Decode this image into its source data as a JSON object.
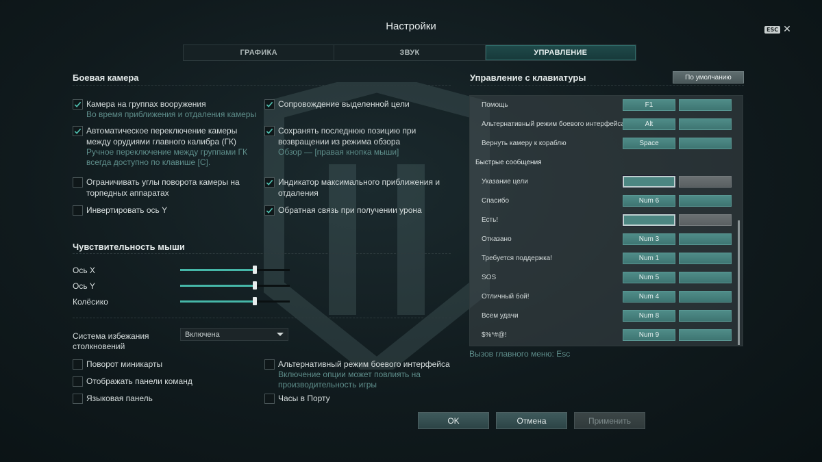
{
  "window": {
    "title": "Настройки",
    "esc_label": "ESC",
    "close_glyph": "✕"
  },
  "tabs": [
    {
      "label": "ГРАФИКА",
      "active": false
    },
    {
      "label": "ЗВУК",
      "active": false
    },
    {
      "label": "УПРАВЛЕНИЕ",
      "active": true
    }
  ],
  "camera": {
    "title": "Боевая камера",
    "left": [
      {
        "label": "Камера на группах вооружения",
        "sub": "Во время приближения и отдаления камеры",
        "checked": true
      },
      {
        "label": "Автоматическое переключение камеры между орудиями главного калибра (ГК)",
        "sub": "Ручное переключение между группами ГК всегда доступно по клавише [C].",
        "checked": true
      },
      {
        "label": "Ограничивать углы поворота камеры на торпедных аппаратах",
        "sub": "",
        "checked": false
      },
      {
        "label": "Инвертировать ось Y",
        "sub": "",
        "checked": false
      }
    ],
    "right": [
      {
        "label": "Сопровождение выделенной цели",
        "sub": "",
        "checked": true
      },
      {
        "label": "Сохранять последнюю позицию при возвращении из режима обзора",
        "sub": "Обзор — [правая кнопка мыши]",
        "checked": true
      },
      {
        "label": "Индикатор максимального приближения и отдаления",
        "sub": "",
        "checked": true
      },
      {
        "label": "Обратная связь при получении урона",
        "sub": "",
        "checked": true
      }
    ]
  },
  "mouse": {
    "title": "Чувствительность мыши",
    "sliders": [
      {
        "label": "Ось X",
        "value": 0.68
      },
      {
        "label": "Ось Y",
        "value": 0.68
      },
      {
        "label": "Колёсико",
        "value": 0.68
      }
    ]
  },
  "collision": {
    "label": "Система избежания столкновений",
    "selected": "Включена"
  },
  "misc": {
    "left": [
      {
        "label": "Поворот миникарты",
        "checked": false
      },
      {
        "label": "Отображать панели команд",
        "checked": false
      },
      {
        "label": "Языковая панель",
        "checked": false
      }
    ],
    "right": [
      {
        "label": "Альтернативный режим боевого интерфейса",
        "sub": "Включение опции может повлиять на производительность игры",
        "checked": false
      },
      {
        "label": "Часы в Порту",
        "sub": "",
        "checked": false
      }
    ]
  },
  "keyboard": {
    "title": "Управление с клавиатуры",
    "default_label": "По умолчанию",
    "group_label": "Быстрые сообщения",
    "rows_top": [
      {
        "name": "Помощь",
        "k1": "F1",
        "k2": ""
      },
      {
        "name": "Альтернативный режим боевого интерфейса",
        "k1": "Alt",
        "k2": ""
      },
      {
        "name": "Вернуть камеру к кораблю",
        "k1": "Space",
        "k2": ""
      }
    ],
    "rows_messages": [
      {
        "name": "Указание цели",
        "k1": "",
        "k2": "",
        "state": "selected"
      },
      {
        "name": "Спасибо",
        "k1": "Num 6",
        "k2": ""
      },
      {
        "name": "Есть!",
        "k1": "",
        "k2": "",
        "state": "selected"
      },
      {
        "name": "Отказано",
        "k1": "Num 3",
        "k2": ""
      },
      {
        "name": "Требуется поддержка!",
        "k1": "Num 1",
        "k2": ""
      },
      {
        "name": "SOS",
        "k1": "Num 5",
        "k2": ""
      },
      {
        "name": "Отличный бой!",
        "k1": "Num 4",
        "k2": ""
      },
      {
        "name": "Всем удачи",
        "k1": "Num 8",
        "k2": ""
      },
      {
        "name": "$%*#@!",
        "k1": "Num 9",
        "k2": ""
      }
    ],
    "hint": "Вызов главного меню: Esc"
  },
  "footer": {
    "ok": "OK",
    "cancel": "Отмена",
    "apply": "Применить"
  },
  "colors": {
    "accent": "#46b7a8",
    "sublabel": "#5e8d8a",
    "active_tab": "#1f4a4a"
  }
}
